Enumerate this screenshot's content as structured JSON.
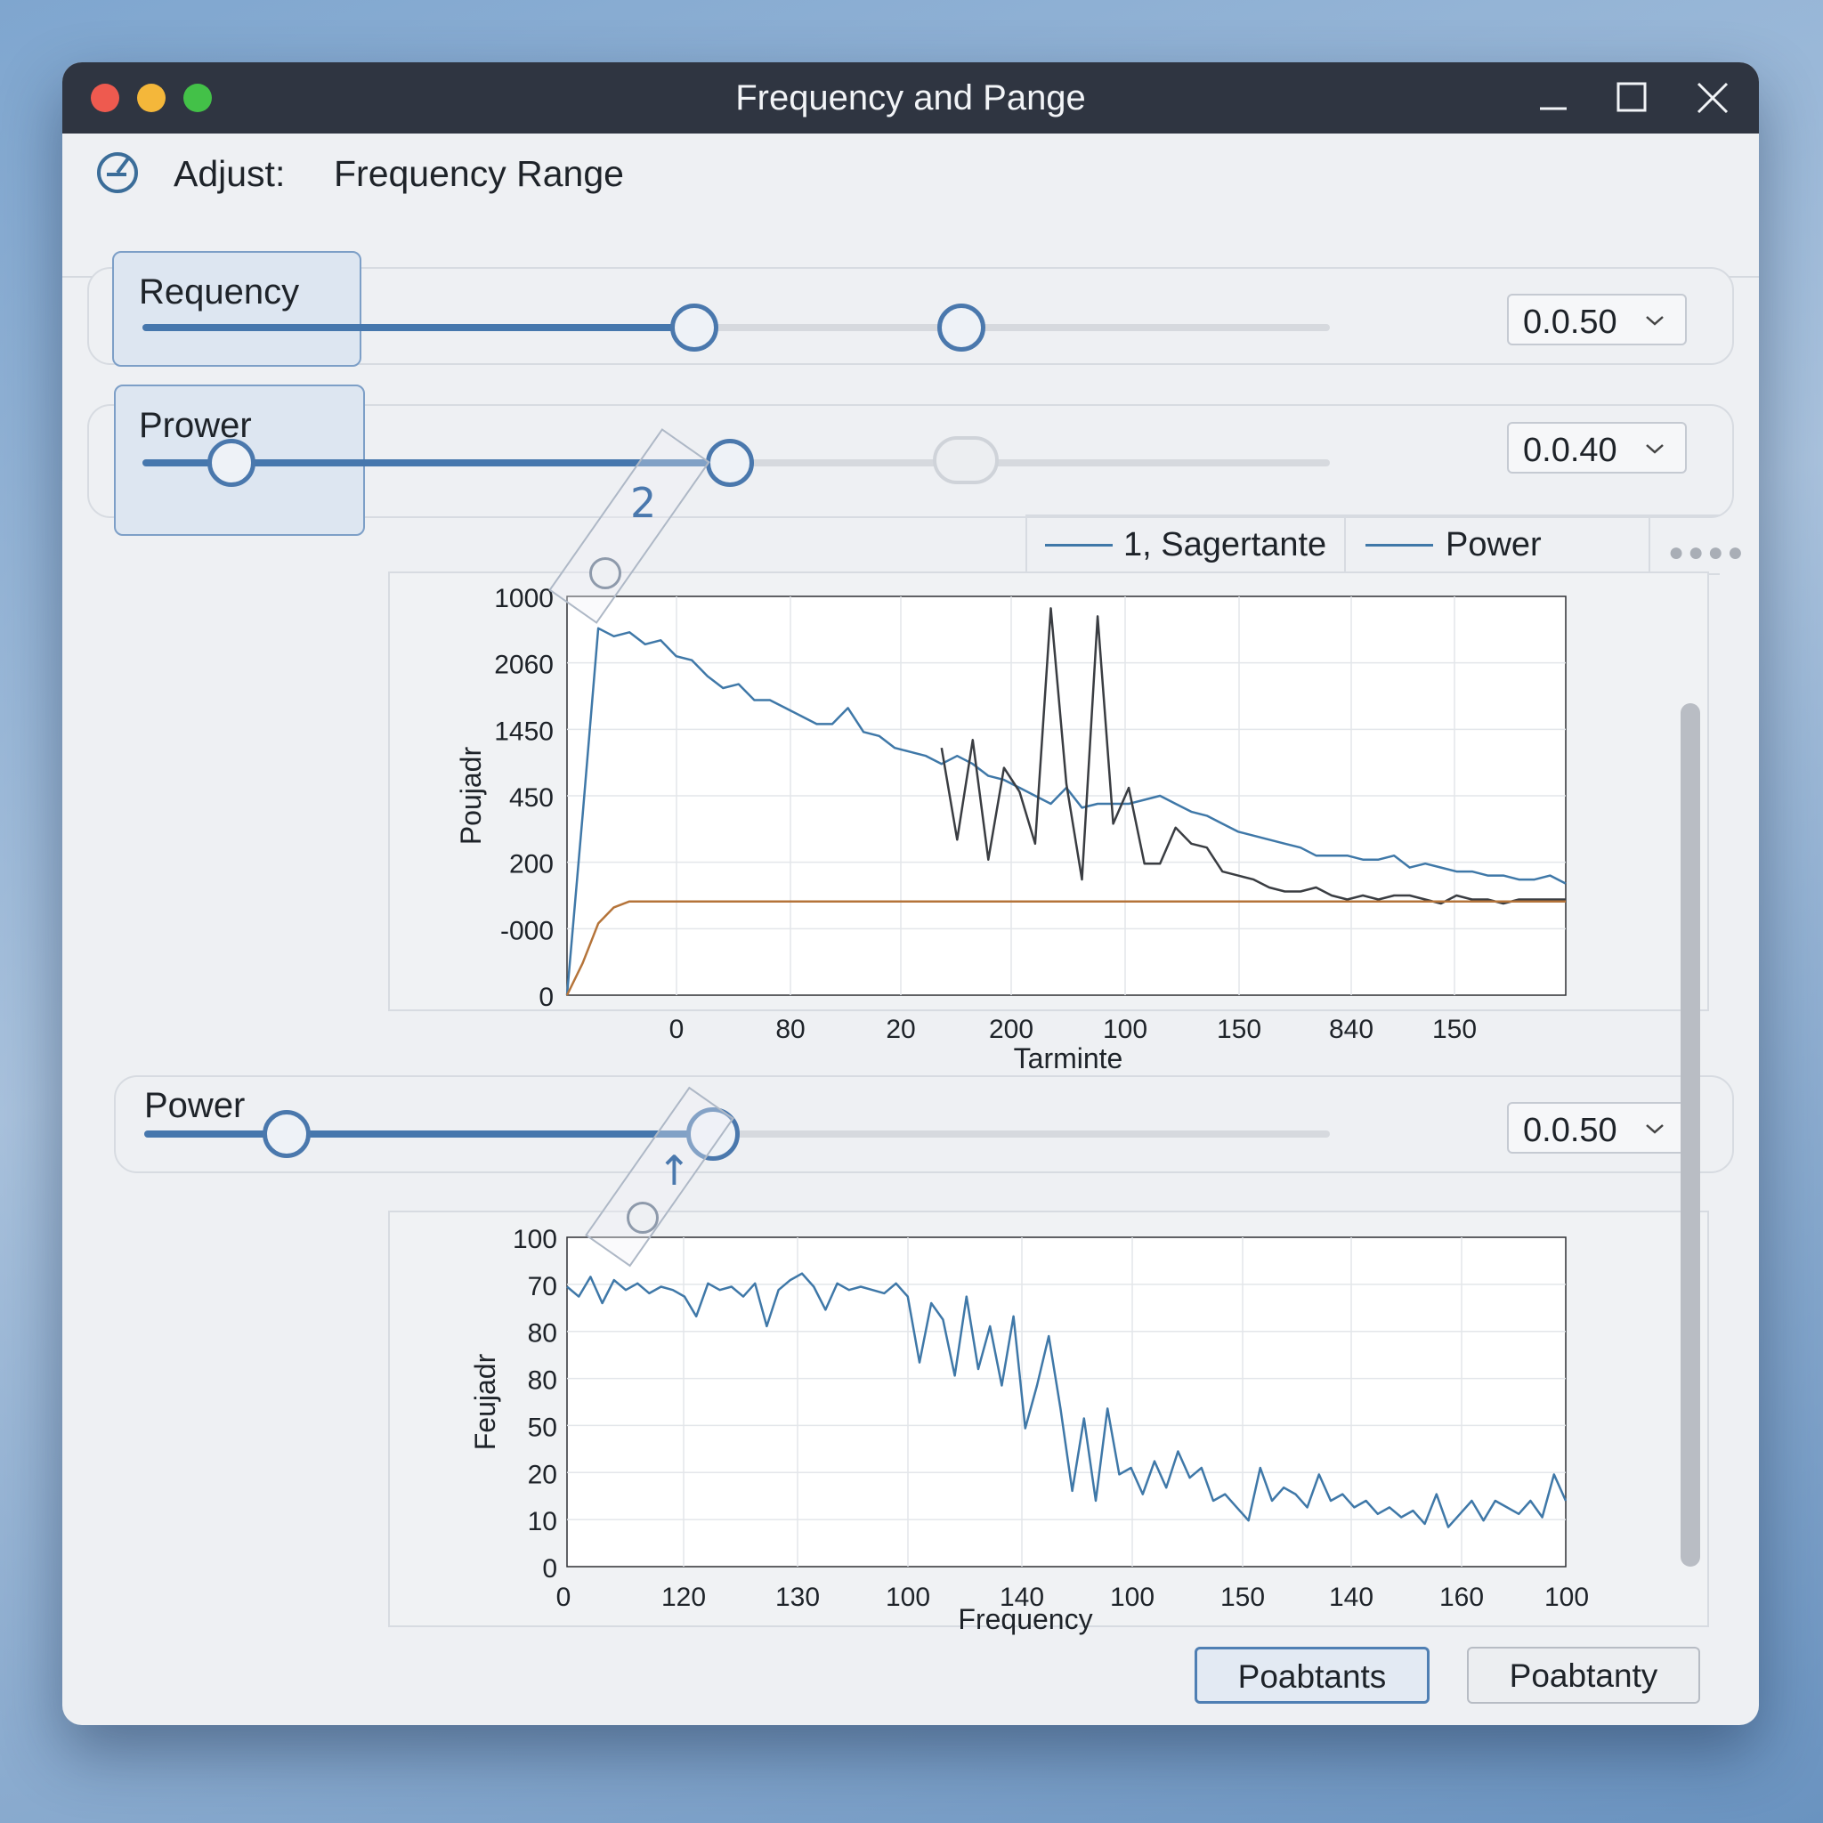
{
  "window": {
    "title": "Frequency and Pange"
  },
  "toolbar": {
    "label": "Adjust:",
    "value": "Frequency Range"
  },
  "rows": {
    "requency": {
      "label": "Requency",
      "value": "0.0.50",
      "low": 0.465,
      "high": 0.69
    },
    "prower": {
      "label": "Prower",
      "value": "0.0.40",
      "low": 0.075,
      "high": 0.495
    },
    "power": {
      "label": "Power",
      "value": "0.0.50",
      "low": 0.12,
      "high": 0.48
    }
  },
  "legend": {
    "items": [
      "1, Sagertante",
      "Power"
    ],
    "color": "#3f78a8"
  },
  "annotations": {
    "first": "2",
    "second": "↑"
  },
  "buttons": {
    "primary": "Poabtants",
    "secondary": "Poabtanty"
  },
  "colors": {
    "accent": "#4677ad",
    "series_blue": "#3f78a8",
    "series_dark": "#3a3d42",
    "series_orange": "#b5743a",
    "titlebar": "#2f3541"
  },
  "chart_data": [
    {
      "type": "line",
      "ylabel": "Poujadr",
      "xlabel": "Tarminte",
      "y_tick_labels": [
        "1000",
        "2060",
        "1450",
        "450",
        "200",
        "-000",
        "0"
      ],
      "x_tick_labels": [
        "0",
        "80",
        "20",
        "200",
        "100",
        "150",
        "840",
        "150"
      ],
      "grid": true,
      "legend": "top-right",
      "series": [
        {
          "name": "1, Sagertante",
          "color": "#3f78a8",
          "values": [
            0.0,
            0.45,
            0.92,
            0.9,
            0.91,
            0.88,
            0.89,
            0.85,
            0.84,
            0.8,
            0.77,
            0.78,
            0.74,
            0.74,
            0.72,
            0.7,
            0.68,
            0.68,
            0.72,
            0.66,
            0.65,
            0.62,
            0.61,
            0.6,
            0.58,
            0.6,
            0.58,
            0.55,
            0.54,
            0.52,
            0.5,
            0.48,
            0.52,
            0.47,
            0.48,
            0.48,
            0.48,
            0.49,
            0.5,
            0.48,
            0.46,
            0.45,
            0.43,
            0.41,
            0.4,
            0.39,
            0.38,
            0.37,
            0.35,
            0.35,
            0.35,
            0.34,
            0.34,
            0.35,
            0.32,
            0.33,
            0.32,
            0.31,
            0.31,
            0.3,
            0.3,
            0.29,
            0.29,
            0.3,
            0.28
          ]
        },
        {
          "name": "",
          "color": "#3a3d42",
          "values": [
            null,
            null,
            null,
            null,
            null,
            null,
            null,
            null,
            null,
            null,
            null,
            null,
            null,
            null,
            null,
            null,
            null,
            null,
            null,
            null,
            null,
            null,
            null,
            null,
            0.62,
            0.39,
            0.64,
            0.34,
            0.57,
            0.51,
            0.38,
            0.97,
            0.53,
            0.29,
            0.95,
            0.43,
            0.52,
            0.33,
            0.33,
            0.42,
            0.38,
            0.37,
            0.31,
            0.3,
            0.29,
            0.27,
            0.26,
            0.26,
            0.27,
            0.25,
            0.24,
            0.25,
            0.24,
            0.25,
            0.25,
            0.24,
            0.23,
            0.25,
            0.24,
            0.24,
            0.23,
            0.24,
            0.24,
            0.24,
            0.24
          ]
        },
        {
          "name": "",
          "color": "#b5743a",
          "values": [
            0.0,
            0.08,
            0.18,
            0.22,
            0.235,
            0.235,
            0.235,
            0.235,
            0.235,
            0.235,
            0.235,
            0.235,
            0.235,
            0.235,
            0.235,
            0.235,
            0.235,
            0.235,
            0.235,
            0.235,
            0.235,
            0.235,
            0.235,
            0.235,
            0.235,
            0.235,
            0.235,
            0.235,
            0.235,
            0.235,
            0.235,
            0.235,
            0.235,
            0.235,
            0.235,
            0.235,
            0.235,
            0.235,
            0.235,
            0.235,
            0.235,
            0.235,
            0.235,
            0.235,
            0.235,
            0.235,
            0.235,
            0.235,
            0.235,
            0.235,
            0.235,
            0.235,
            0.235,
            0.235,
            0.235,
            0.235,
            0.235,
            0.235,
            0.235,
            0.235,
            0.235,
            0.235,
            0.235,
            0.235,
            0.235
          ]
        }
      ]
    },
    {
      "type": "line",
      "ylabel": "Feujadr",
      "xlabel": "Frequency",
      "y_tick_labels": [
        "100",
        "70",
        "80",
        "80",
        "50",
        "20",
        "10",
        "0"
      ],
      "x_tick_labels": [
        "0",
        "120",
        "130",
        "100",
        "140",
        "100",
        "150",
        "140",
        "160",
        "100"
      ],
      "grid": true,
      "series": [
        {
          "name": "",
          "color": "#3f78a8",
          "values": [
            0.85,
            0.82,
            0.88,
            0.8,
            0.87,
            0.84,
            0.86,
            0.83,
            0.85,
            0.84,
            0.82,
            0.76,
            0.86,
            0.84,
            0.85,
            0.82,
            0.86,
            0.73,
            0.84,
            0.87,
            0.89,
            0.85,
            0.78,
            0.86,
            0.84,
            0.85,
            0.84,
            0.83,
            0.86,
            0.82,
            0.62,
            0.8,
            0.75,
            0.58,
            0.82,
            0.6,
            0.73,
            0.55,
            0.76,
            0.42,
            0.55,
            0.7,
            0.48,
            0.23,
            0.45,
            0.2,
            0.48,
            0.28,
            0.3,
            0.22,
            0.32,
            0.24,
            0.35,
            0.27,
            0.3,
            0.2,
            0.22,
            0.18,
            0.14,
            0.3,
            0.2,
            0.24,
            0.22,
            0.18,
            0.28,
            0.2,
            0.22,
            0.18,
            0.2,
            0.16,
            0.18,
            0.15,
            0.17,
            0.13,
            0.22,
            0.12,
            0.16,
            0.2,
            0.14,
            0.2,
            0.18,
            0.16,
            0.2,
            0.15,
            0.28,
            0.2
          ]
        }
      ]
    }
  ]
}
